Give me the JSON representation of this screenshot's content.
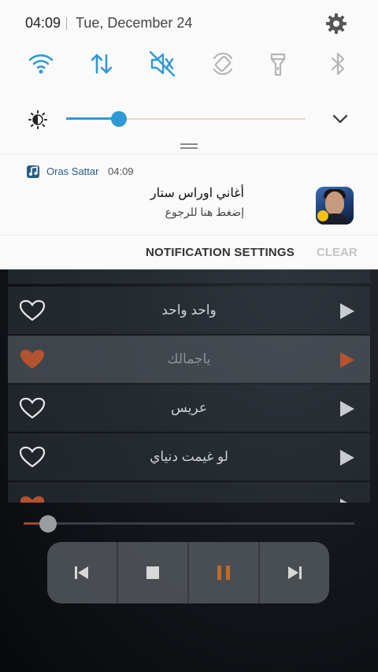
{
  "status": {
    "time": "04:09",
    "date": "Tue, December 24"
  },
  "quick_settings": {
    "accent": "#2d9ad6",
    "inactive": "#b5b5b5",
    "toggles": [
      {
        "icon": "wifi-icon",
        "state": "on"
      },
      {
        "icon": "mobile-data-icon",
        "state": "on"
      },
      {
        "icon": "sound-mute-icon",
        "state": "on"
      },
      {
        "icon": "auto-rotate-icon",
        "state": "off"
      },
      {
        "icon": "flashlight-icon",
        "state": "off"
      },
      {
        "icon": "bluetooth-icon",
        "state": "off"
      }
    ],
    "brightness_level": 0.2
  },
  "notification": {
    "app_name": "Oras Sattar",
    "time": "04:09",
    "title": "أغاني اوراس ستار",
    "text": "إضغط هنا للرجوع"
  },
  "shade_actions": {
    "settings_label": "NOTIFICATION SETTINGS",
    "clear_label": "CLEAR"
  },
  "player": {
    "accent": "#b5532e",
    "songs": [
      {
        "title": "واحد واحد",
        "favorite": false,
        "active": false
      },
      {
        "title": "ياجمالك",
        "favorite": true,
        "active": true
      },
      {
        "title": "عريس",
        "favorite": false,
        "active": false
      },
      {
        "title": "لو غيمت دنياي",
        "favorite": false,
        "active": false
      }
    ],
    "progress": 0.05,
    "controls": [
      "previous-icon",
      "stop-icon",
      "pause-icon",
      "next-icon"
    ]
  }
}
